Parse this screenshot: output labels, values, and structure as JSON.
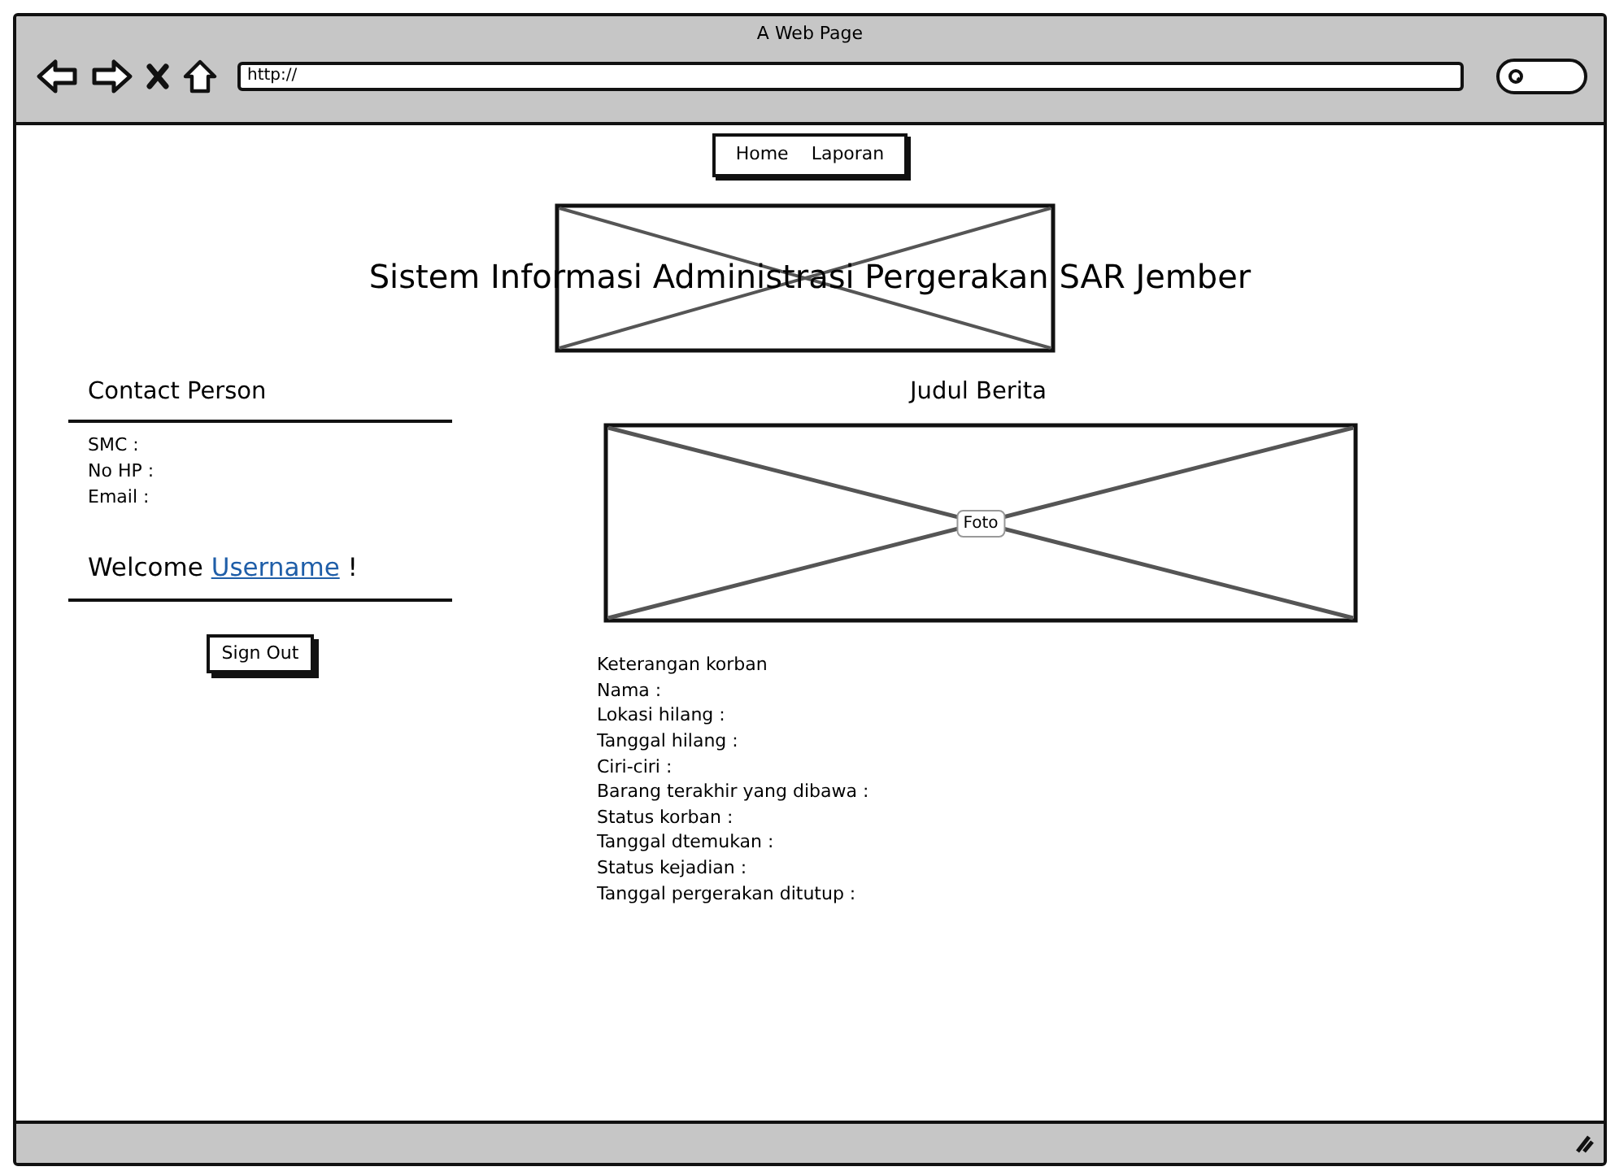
{
  "window": {
    "title": "A Web Page"
  },
  "address_bar": {
    "value": "http://"
  },
  "nav": [
    {
      "label": "Home"
    },
    {
      "label": "Laporan"
    }
  ],
  "header": {
    "title": "Sistem Informasi Administrasi Pergerakan SAR Jember"
  },
  "contact": {
    "heading": "Contact Person",
    "fields": [
      "SMC :",
      "No HP :",
      "Email :"
    ]
  },
  "welcome": {
    "text": "Welcome",
    "username": "Username",
    "suffix": "!"
  },
  "sign_out": {
    "label": "Sign Out"
  },
  "news": {
    "title": "Judul Berita",
    "photo_label": "Foto",
    "details": [
      "Keterangan korban",
      "Nama :",
      "Lokasi hilang :",
      "Tanggal hilang :",
      "Ciri-ciri :",
      "Barang terakhir yang dibawa :",
      "Status korban :",
      "Tanggal dtemukan :",
      "Status kejadian :",
      "Tanggal pergerakan ditutup :"
    ]
  }
}
